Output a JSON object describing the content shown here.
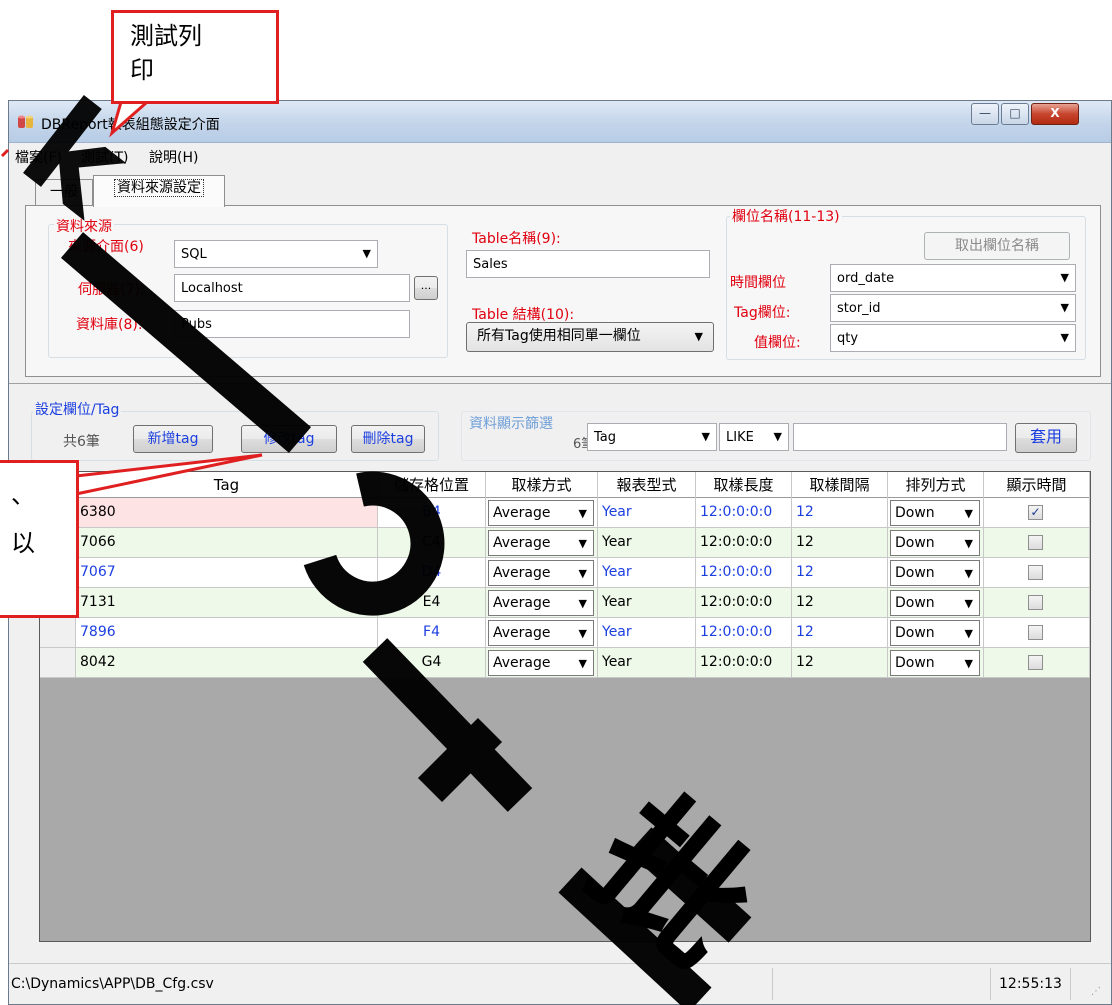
{
  "callouts": {
    "top_line1": "測試列",
    "top_line2": "印",
    "left_line1": "、",
    "left_line2": "以"
  },
  "window": {
    "title": "DBReport報表組態設定介面",
    "buttons": {
      "minimize": "—",
      "maximize": "□",
      "close": "X"
    }
  },
  "menu": {
    "file": "檔案(F)",
    "test": "測試(T)",
    "help": "說明(H)"
  },
  "tabs": {
    "general": "一般",
    "datasource": "資料來源設定"
  },
  "datasource": {
    "group_label": "資料來源",
    "interface_label": "來源介面(6)",
    "interface_value": "SQL",
    "server_label": "伺服器(7):",
    "server_value": "Localhost",
    "browse_button": "...",
    "database_label": "資料庫(8):",
    "database_value": "Pubs"
  },
  "table": {
    "name_label": "Table名稱(9):",
    "name_value": "Sales",
    "structure_label": "Table 結構(10):",
    "structure_value": "所有Tag使用相同單一欄位"
  },
  "fields": {
    "group_label": "欄位名稱(11-13)",
    "get_button": "取出欄位名稱",
    "time_label": "時間欄位",
    "time_value": "ord_date",
    "tag_label": "Tag欄位:",
    "tag_value": "stor_id",
    "value_label": "值欄位:",
    "value_value": "qty"
  },
  "tagset": {
    "group_label": "設定欄位/Tag",
    "count_text": "共6筆",
    "add_button": "新增tag",
    "edit_button": "修改tag",
    "delete_button": "刪除tag"
  },
  "filter": {
    "group_label": "資料顯示篩選",
    "count_text": "6筆",
    "field_value": "Tag",
    "operator_value": "LIKE",
    "text_value": "",
    "apply_button": "套用"
  },
  "grid": {
    "columns": [
      "Tag",
      "儲存格位置",
      "取樣方式",
      "報表型式",
      "取樣長度",
      "取樣間隔",
      "排列方式",
      "顯示時間"
    ],
    "rows": [
      {
        "tag": "6380",
        "cell": "B4",
        "method": "Average",
        "type": "Year",
        "length": "12:0:0:0:0",
        "interval": "12",
        "order": "Down",
        "show_time": true,
        "style": "selected"
      },
      {
        "tag": "7066",
        "cell": "C4",
        "method": "Average",
        "type": "Year",
        "length": "12:0:0:0:0",
        "interval": "12",
        "order": "Down",
        "show_time": false,
        "style": "alt"
      },
      {
        "tag": "7067",
        "cell": "D4",
        "method": "Average",
        "type": "Year",
        "length": "12:0:0:0:0",
        "interval": "12",
        "order": "Down",
        "show_time": false,
        "style": "blue"
      },
      {
        "tag": "7131",
        "cell": "E4",
        "method": "Average",
        "type": "Year",
        "length": "12:0:0:0:0",
        "interval": "12",
        "order": "Down",
        "show_time": false,
        "style": "alt"
      },
      {
        "tag": "7896",
        "cell": "F4",
        "method": "Average",
        "type": "Year",
        "length": "12:0:0:0:0",
        "interval": "12",
        "order": "Down",
        "show_time": false,
        "style": "blue"
      },
      {
        "tag": "8042",
        "cell": "G4",
        "method": "Average",
        "type": "Year",
        "length": "12:0:0:0:0",
        "interval": "12",
        "order": "Down",
        "show_time": false,
        "style": "alt"
      }
    ]
  },
  "status": {
    "path": "C:\\Dynamics\\APP\\DB_Cfg.csv",
    "time": "12:55:13"
  },
  "colors": {
    "accent_red": "#e0000f",
    "link_blue": "#1c3fe0",
    "row_green": "#eef9ea",
    "row_selected": "#fde3e3",
    "grid_bg": "#a9a9a9"
  },
  "watermark": {
    "glyph": "k",
    "char1": "批"
  }
}
